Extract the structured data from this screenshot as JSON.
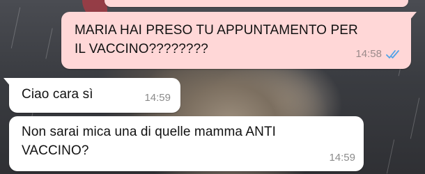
{
  "chat": {
    "messages": [
      {
        "direction": "outgoing",
        "text": "MARIA HAI PRESO TU APPUNTAMENTO PER\nIL VACCINO????????",
        "time": "14:58",
        "status_icon": "double-check-read-icon"
      },
      {
        "direction": "incoming",
        "text": "Ciao cara sì",
        "time": "14:59"
      },
      {
        "direction": "incoming",
        "text": "Non sarai mica una di quelle mamma ANTI\nVACCINO?",
        "time": "14:59"
      }
    ]
  },
  "colors": {
    "outgoing_bubble": "#ffd7d7",
    "incoming_bubble": "#ffffff",
    "read_ticks": "#4fa3e8",
    "timestamp": "#8b8b8b"
  }
}
